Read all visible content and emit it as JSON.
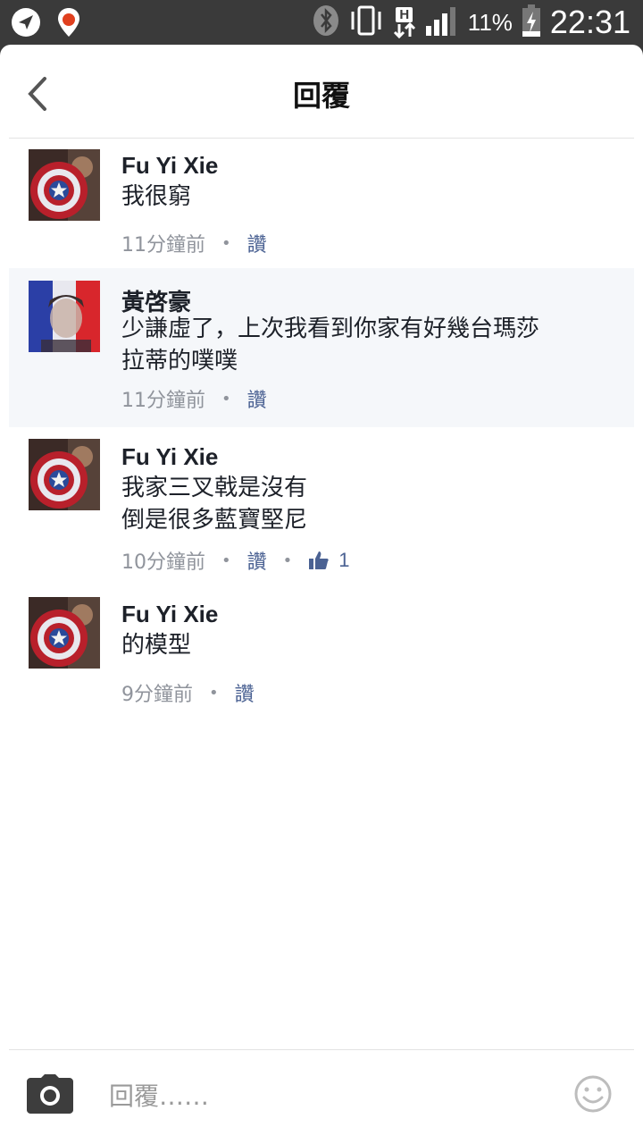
{
  "status_bar": {
    "icons": [
      "navigation-icon",
      "location-pin-icon",
      "bluetooth-icon",
      "vibrate-icon",
      "h-plus-data-icon",
      "signal-icon",
      "battery-charging-icon"
    ],
    "network_type": "H",
    "battery": "11%",
    "time": "22:31"
  },
  "header": {
    "title": "回覆",
    "back_icon": "chevron-left-icon"
  },
  "comments": [
    {
      "author": "Fu Yi Xie",
      "text": "我很窮",
      "time": "11分鐘前",
      "like_label": "讚",
      "like_count": ""
    },
    {
      "author": "黃啓豪",
      "text": "少謙虛了，上次我看到你家有好幾台瑪莎\n拉蒂的噗噗",
      "time": "11分鐘前",
      "like_label": "讚",
      "like_count": ""
    },
    {
      "author": "Fu Yi Xie",
      "text": "我家三叉戟是沒有\n倒是很多藍寶堅尼",
      "time": "10分鐘前",
      "like_label": "讚",
      "like_count": "1"
    },
    {
      "author": "Fu Yi Xie",
      "text": "的模型",
      "time": "9分鐘前",
      "like_label": "讚",
      "like_count": ""
    }
  ],
  "composer": {
    "placeholder": "回覆……",
    "camera_icon": "camera-icon",
    "emoji_icon": "smiley-icon"
  },
  "colors": {
    "status_bar": "#3a3a3a",
    "text": "#1d2129",
    "meta": "#90949c",
    "link": "#4b6293",
    "highlight": "#f5f7fa"
  }
}
